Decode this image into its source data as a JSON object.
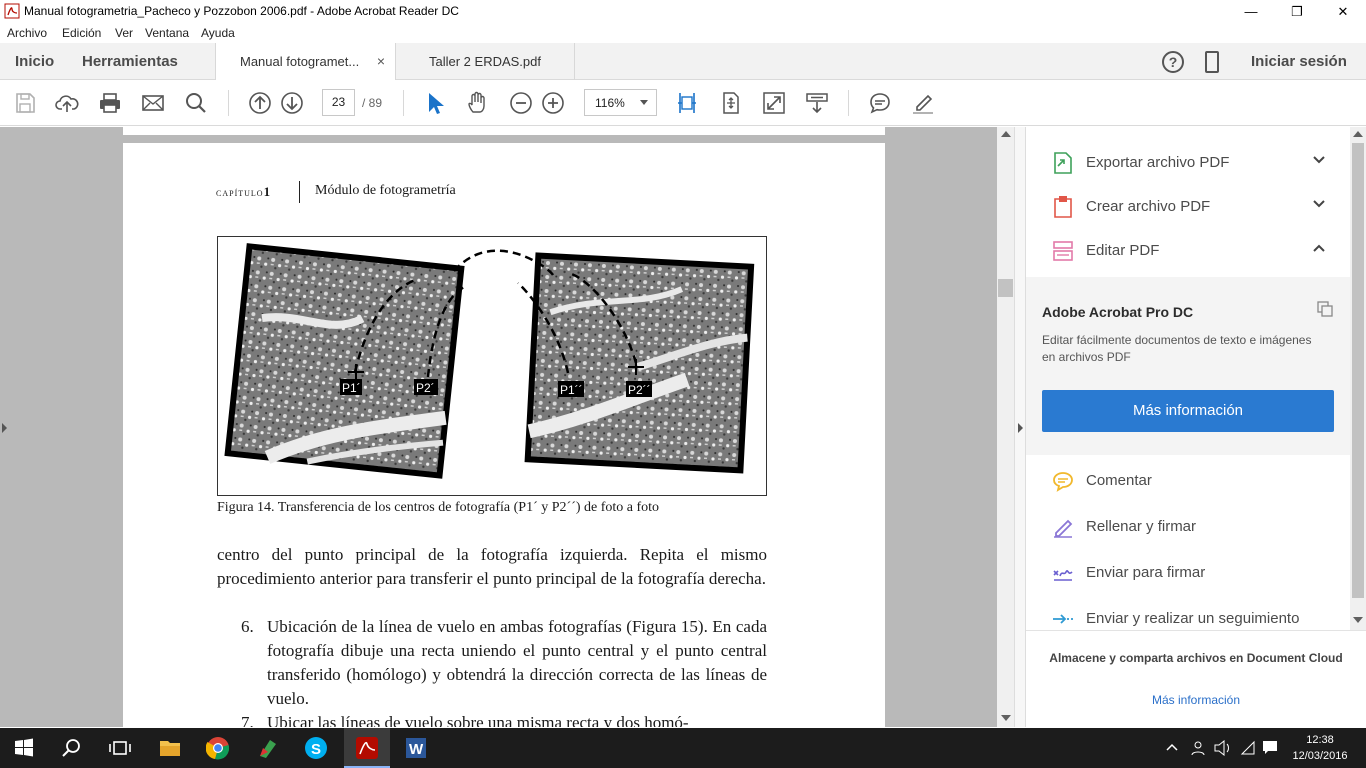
{
  "window": {
    "title": "Manual fotogrametria_Pacheco y Pozzobon 2006.pdf - Adobe Acrobat Reader DC",
    "app_icon": "acrobat-icon",
    "minimize": "—",
    "maximize": "❐",
    "close": "✕"
  },
  "menu": [
    "Archivo",
    "Edición",
    "Ver",
    "Ventana",
    "Ayuda"
  ],
  "tabs": {
    "home": "Inicio",
    "tools": "Herramientas",
    "documents": [
      {
        "label": "Manual fotogramet...",
        "close": "×",
        "active": true
      },
      {
        "label": "Taller 2 ERDAS.pdf",
        "active": false
      }
    ],
    "help": "?",
    "signin": "Iniciar sesión"
  },
  "toolbar": {
    "current_page": "23",
    "page_total": "/  89",
    "zoom": "116%",
    "icons": [
      "save-icon",
      "upload-icon",
      "print-icon",
      "mail-icon",
      "search-icon",
      "page-up-icon",
      "page-down-icon",
      "select-icon",
      "hand-icon",
      "zoom-out-icon",
      "zoom-in-icon",
      "fit-width-icon",
      "fit-page-icon",
      "full-screen-icon",
      "read-mode-icon",
      "comment-icon",
      "highlight-icon"
    ]
  },
  "document": {
    "chapter_label": "capítulo",
    "chapter_number": "1",
    "chapter_title": "Módulo de fotogrametría",
    "figure_labels": {
      "p1a": "P1´",
      "p2a": "P2´",
      "p1b": "P1´´",
      "p2b": "P2´´"
    },
    "caption": "Figura 14. Transferencia de los centros de fotografía (P1´ y P2´´) de foto a foto",
    "paragraph": "centro del punto principal de la fotografía izquierda. Repita el mismo procedimiento anterior para transferir el punto principal de la fotografía derecha.",
    "item6_num": "6.",
    "item6": "Ubicación de la línea de vuelo en ambas fotografías (Figura 15). En cada fotografía dibuje una recta uniendo el punto central y el punto central transferido (homólogo) y obtendrá la dirección correcta de las líneas de vuelo.",
    "item7_num": "7.",
    "item7": "Ubicar las líneas de vuelo sobre una misma recta y dos homó-"
  },
  "right_pane": {
    "tools": [
      {
        "label": "Exportar archivo PDF",
        "icon": "export-pdf-icon",
        "color": "#3ea15a",
        "expanded": false
      },
      {
        "label": "Crear archivo PDF",
        "icon": "create-pdf-icon",
        "color": "#e15648",
        "expanded": false
      },
      {
        "label": "Editar PDF",
        "icon": "edit-pdf-icon",
        "color": "#e27aa8",
        "expanded": true
      }
    ],
    "promo": {
      "title": "Adobe Acrobat Pro DC",
      "description": "Editar fácilmente documentos de texto e imágenes en archivos PDF",
      "button": "Más información",
      "button_color": "#2a7ad1"
    },
    "more_tools": [
      {
        "label": "Comentar",
        "icon": "comment-bubble-icon",
        "color": "#f1b82c"
      },
      {
        "label": "Rellenar y firmar",
        "icon": "fill-sign-icon",
        "color": "#8a76d6"
      },
      {
        "label": "Enviar para firmar",
        "icon": "send-sign-icon",
        "color": "#6a5fd0"
      },
      {
        "label": "Enviar y realizar un seguimiento",
        "icon": "send-track-icon",
        "color": "#2f9ad3"
      }
    ],
    "footer_text": "Almacene y comparta archivos en Document Cloud",
    "footer_link": "Más información"
  },
  "taskbar": {
    "apps": [
      "start-icon",
      "search-icon",
      "task-view-icon",
      "file-explorer-icon",
      "chrome-icon",
      "app-icon",
      "skype-icon",
      "acrobat-icon",
      "word-icon"
    ],
    "time": "12:38",
    "date": "12/03/2016"
  }
}
